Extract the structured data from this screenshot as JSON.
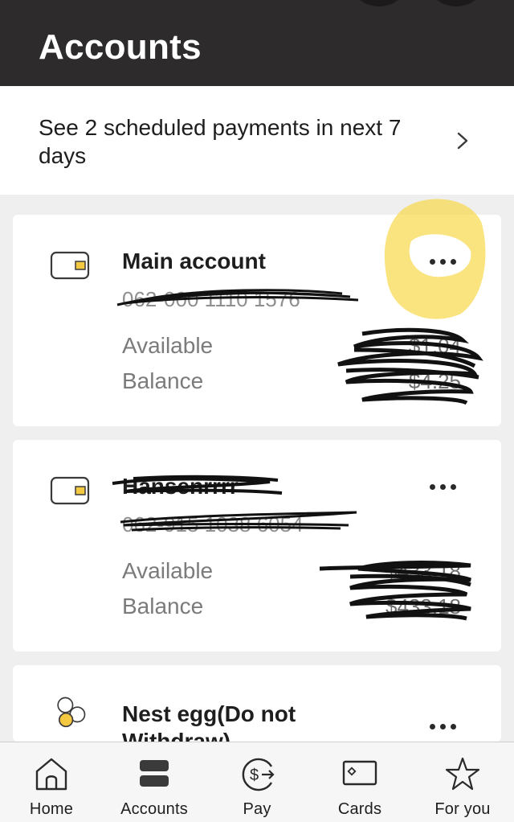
{
  "header": {
    "title": "Accounts"
  },
  "scheduled": {
    "text": "See 2 scheduled payments in next 7 days",
    "icon": "chevron-right-icon"
  },
  "accounts": [
    {
      "name": "Main account",
      "number": "062-000 1110 1576",
      "balance_label": "Available Balance",
      "available": "$1.04",
      "balance": "$4.25",
      "icon": "wallet-icon"
    },
    {
      "name": "Hansenrrrr",
      "number": "062-915 1038 6054",
      "balance_label": "Available Balance",
      "available": "$433.18",
      "balance": "$433.18",
      "icon": "wallet-icon"
    },
    {
      "name": "Nest egg(Do not Withdraw)",
      "icon": "savings-coins-icon"
    }
  ],
  "tabs": [
    {
      "label": "Home",
      "icon": "home-icon"
    },
    {
      "label": "Accounts",
      "icon": "accounts-icon"
    },
    {
      "label": "Pay",
      "icon": "pay-icon"
    },
    {
      "label": "Cards",
      "icon": "card-icon"
    },
    {
      "label": "For you",
      "icon": "star-icon"
    }
  ],
  "colors": {
    "header_bg": "#2d2b2b",
    "accent_yellow": "#f5c842",
    "highlight": "#f8d84a",
    "page_bg": "#efefef"
  }
}
